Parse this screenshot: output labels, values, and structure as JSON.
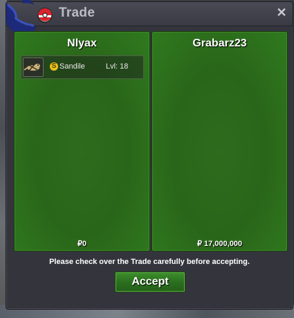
{
  "window": {
    "title": "Trade",
    "close_icon": "close-icon"
  },
  "left_panel": {
    "player_name": "Nlyax",
    "items": [
      {
        "badge": "S",
        "name": "Sandile",
        "level": "Lvl: 18",
        "icon": "sandile-sprite-icon"
      }
    ],
    "money": "₽0"
  },
  "right_panel": {
    "player_name": "Grabarz23",
    "items": [],
    "money": "₽ 17,000,000"
  },
  "notice": "Please check over the Trade carefully before accepting.",
  "accept_label": "Accept",
  "colors": {
    "panel_green": "#2a6619",
    "window_bg": "#34343d",
    "title_text": "#b9bcc6",
    "badge_gold": "#e8c21a"
  }
}
